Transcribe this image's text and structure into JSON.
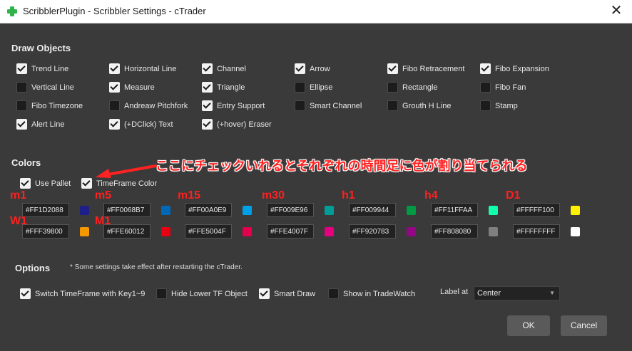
{
  "window": {
    "title": "ScribblerPlugin - Scribbler Settings - cTrader",
    "close_glyph": "✕"
  },
  "draw_objects": {
    "heading": "Draw Objects",
    "items": [
      {
        "label": "Trend Line",
        "checked": true
      },
      {
        "label": "Horizontal Line",
        "checked": true
      },
      {
        "label": "Channel",
        "checked": true
      },
      {
        "label": "Arrow",
        "checked": true
      },
      {
        "label": "Fibo Retracement",
        "checked": true
      },
      {
        "label": "Fibo Expansion",
        "checked": true
      },
      {
        "label": "Vertical Line",
        "checked": false
      },
      {
        "label": "Measure",
        "checked": true
      },
      {
        "label": "Triangle",
        "checked": true
      },
      {
        "label": "Ellipse",
        "checked": false
      },
      {
        "label": "Rectangle",
        "checked": false
      },
      {
        "label": "Fibo Fan",
        "checked": false
      },
      {
        "label": "Fibo Timezone",
        "checked": false
      },
      {
        "label": "Andreaw Pitchfork",
        "checked": false
      },
      {
        "label": "Entry Support",
        "checked": true
      },
      {
        "label": "Smart Channel",
        "checked": false
      },
      {
        "label": "Grouth H Line",
        "checked": false
      },
      {
        "label": "Stamp",
        "checked": false
      },
      {
        "label": "Alert Line",
        "checked": true
      },
      {
        "label": "(+DClick) Text",
        "checked": true
      },
      {
        "label": "(+hover) Eraser",
        "checked": true
      }
    ]
  },
  "colors": {
    "heading": "Colors",
    "use_pallet": {
      "label": "Use Pallet",
      "checked": true
    },
    "timeframe_color": {
      "label": "TimeFrame Color",
      "checked": true
    },
    "annotation": "ここにチェックいれるとそれぞれの時間足に色が割り当てられる",
    "annotation_color": "#ff2222",
    "timeframes": [
      {
        "tf": "m1",
        "value": "#FF1D2088",
        "swatch": "#1D2088"
      },
      {
        "tf": "m5",
        "value": "#FF0068B7",
        "swatch": "#0068B7"
      },
      {
        "tf": "m15",
        "value": "#FF00A0E9",
        "swatch": "#00A0E9"
      },
      {
        "tf": "m30",
        "value": "#FF009E96",
        "swatch": "#009E96"
      },
      {
        "tf": "h1",
        "value": "#FF009944",
        "swatch": "#009944"
      },
      {
        "tf": "h4",
        "value": "#FF11FFAA",
        "swatch": "#11FFAA"
      },
      {
        "tf": "D1",
        "value": "#FFFFF100",
        "swatch": "#FFF100"
      },
      {
        "tf": "W1",
        "value": "#FFF39800",
        "swatch": "#F39800"
      },
      {
        "tf": "M1",
        "value": "#FFE60012",
        "swatch": "#E60012"
      },
      {
        "tf": "",
        "value": "#FFE5004F",
        "swatch": "#E5004F"
      },
      {
        "tf": "",
        "value": "#FFE4007F",
        "swatch": "#E4007F"
      },
      {
        "tf": "",
        "value": "#FF920783",
        "swatch": "#920783"
      },
      {
        "tf": "",
        "value": "#FF808080",
        "swatch": "#808080"
      },
      {
        "tf": "",
        "value": "#FFFFFFFF",
        "swatch": "#FFFFFF"
      }
    ]
  },
  "options": {
    "heading": "Options",
    "note": "* Some settings take effect after restarting the cTrader.",
    "items": [
      {
        "label": "Switch TimeFrame with Key1~9",
        "checked": true
      },
      {
        "label": "Hide Lower TF Object",
        "checked": false
      },
      {
        "label": "Smart Draw",
        "checked": true
      },
      {
        "label": "Show in TradeWatch",
        "checked": false
      }
    ],
    "label_at": {
      "label": "Label at",
      "value": "Center"
    }
  },
  "buttons": {
    "ok": "OK",
    "cancel": "Cancel"
  }
}
